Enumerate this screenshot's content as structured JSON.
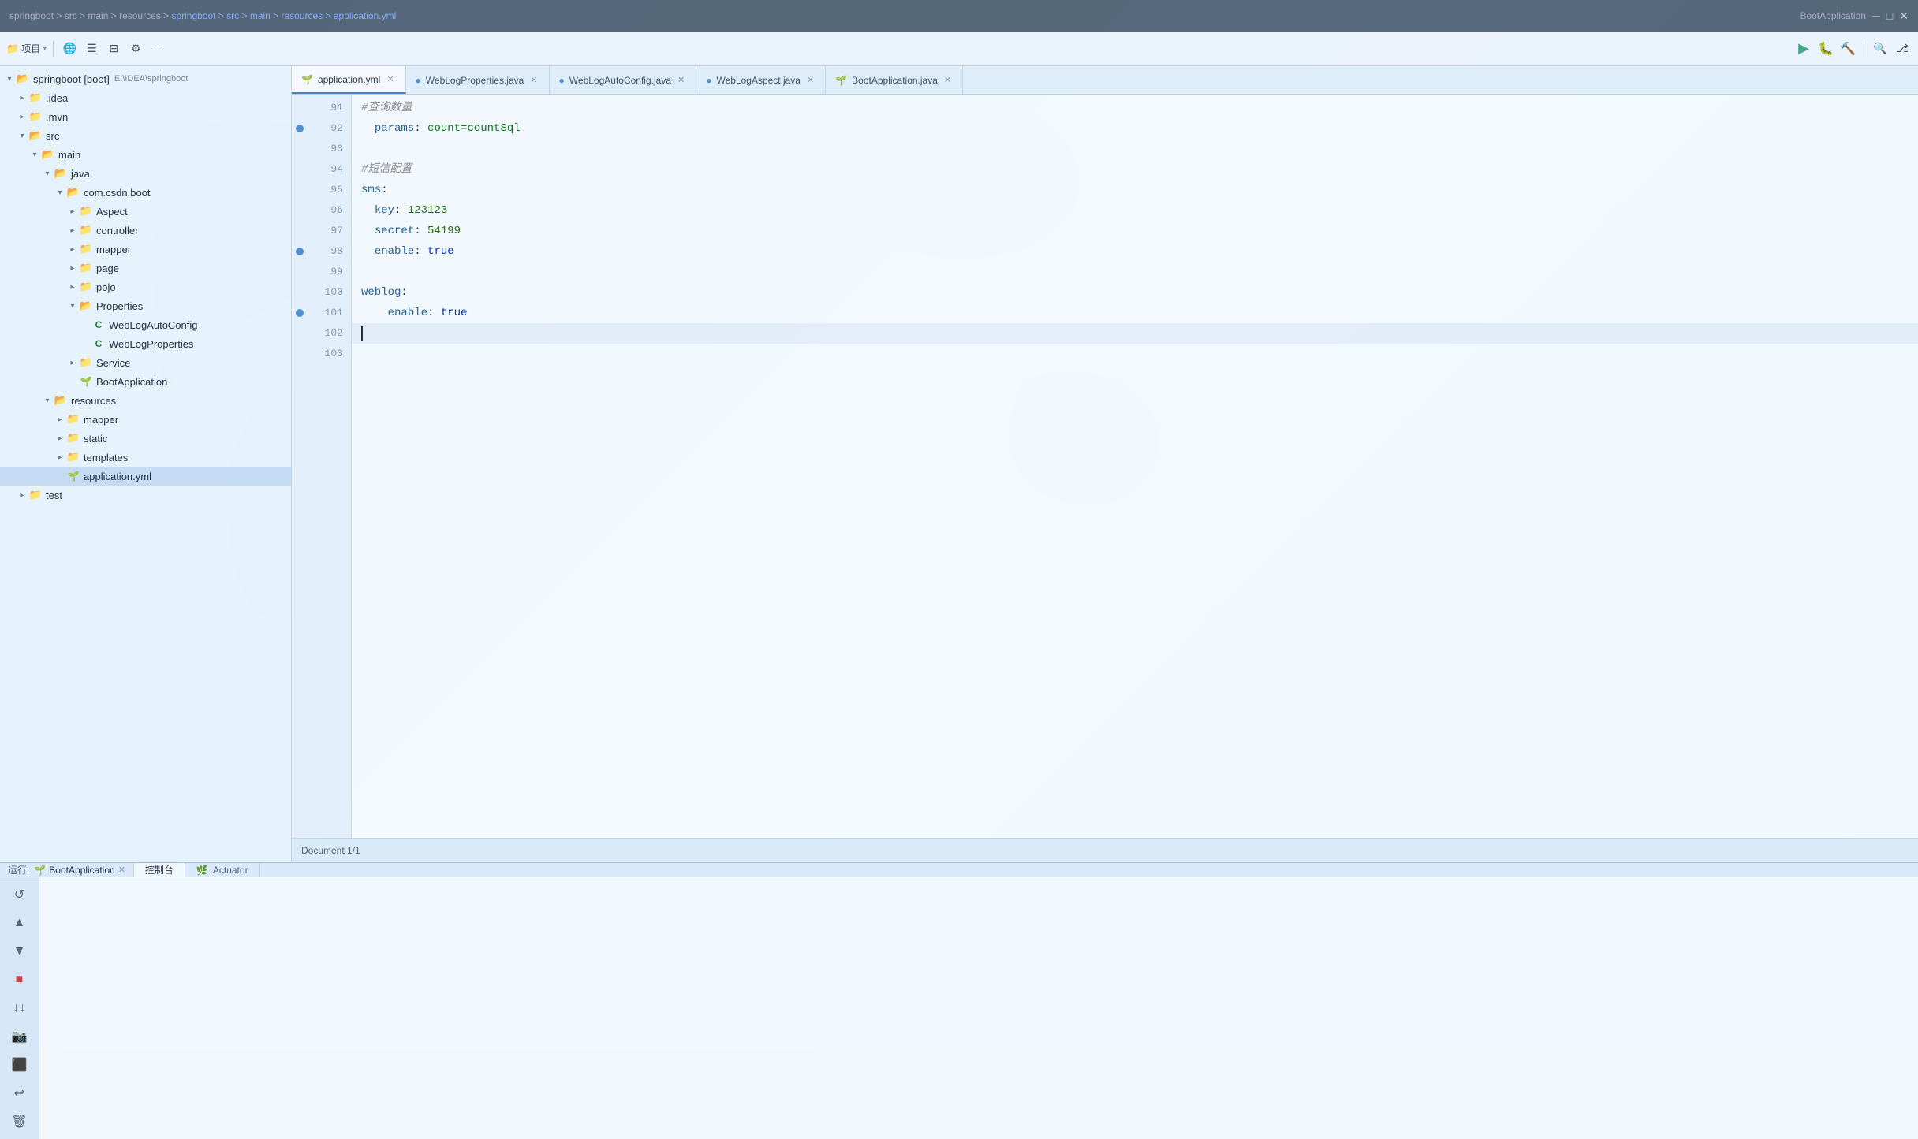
{
  "titleBar": {
    "path": "springboot > src > main > resources > application.yml",
    "appName": "BootApplication"
  },
  "toolbar": {
    "projectLabel": "项目",
    "icons": [
      "globe",
      "align-center",
      "settings",
      "minimize"
    ]
  },
  "tabs": [
    {
      "id": "application-yml",
      "label": "application.yml",
      "type": "yaml",
      "active": true
    },
    {
      "id": "weblog-properties",
      "label": "WebLogProperties.java",
      "type": "java",
      "active": false
    },
    {
      "id": "weblog-autoconfig",
      "label": "WebLogAutoConfig.java",
      "type": "java",
      "active": false
    },
    {
      "id": "weblog-aspect",
      "label": "WebLogAspect.java",
      "type": "java",
      "active": false
    },
    {
      "id": "boot-application",
      "label": "BootApplication.java",
      "type": "java",
      "active": false
    }
  ],
  "sidebar": {
    "rootLabel": "springboot [boot]",
    "rootPath": "E:\\IDEA\\springboot",
    "tree": [
      {
        "id": "idea",
        "label": ".idea",
        "type": "folder",
        "level": 1,
        "expanded": false
      },
      {
        "id": "mvn",
        "label": ".mvn",
        "type": "folder",
        "level": 1,
        "expanded": false
      },
      {
        "id": "src",
        "label": "src",
        "type": "folder",
        "level": 1,
        "expanded": true
      },
      {
        "id": "main",
        "label": "main",
        "type": "folder",
        "level": 2,
        "expanded": true
      },
      {
        "id": "java",
        "label": "java",
        "type": "folder",
        "level": 3,
        "expanded": true
      },
      {
        "id": "com-csdn-boot",
        "label": "com.csdn.boot",
        "type": "folder",
        "level": 4,
        "expanded": true
      },
      {
        "id": "aspect",
        "label": "Aspect",
        "type": "folder",
        "level": 5,
        "expanded": false
      },
      {
        "id": "controller",
        "label": "controller",
        "type": "folder",
        "level": 5,
        "expanded": false
      },
      {
        "id": "mapper",
        "label": "mapper",
        "type": "folder",
        "level": 5,
        "expanded": false
      },
      {
        "id": "page",
        "label": "page",
        "type": "folder",
        "level": 5,
        "expanded": false
      },
      {
        "id": "pojo",
        "label": "pojo",
        "type": "folder",
        "level": 5,
        "expanded": false
      },
      {
        "id": "properties",
        "label": "Properties",
        "type": "folder",
        "level": 5,
        "expanded": true
      },
      {
        "id": "weblogautoconfig",
        "label": "WebLogAutoConfig",
        "type": "java-spring",
        "level": 6
      },
      {
        "id": "weblogproperties",
        "label": "WebLogProperties",
        "type": "java-spring",
        "level": 6
      },
      {
        "id": "service",
        "label": "Service",
        "type": "folder",
        "level": 5,
        "expanded": false
      },
      {
        "id": "bootapplication",
        "label": "BootApplication",
        "type": "java-spring",
        "level": 5
      },
      {
        "id": "resources",
        "label": "resources",
        "type": "folder",
        "level": 3,
        "expanded": true
      },
      {
        "id": "mapper-res",
        "label": "mapper",
        "type": "folder",
        "level": 4,
        "expanded": false
      },
      {
        "id": "static",
        "label": "static",
        "type": "folder",
        "level": 4,
        "expanded": false
      },
      {
        "id": "templates",
        "label": "templates",
        "type": "folder",
        "level": 4,
        "expanded": false
      },
      {
        "id": "appyml",
        "label": "application.yml",
        "type": "yaml",
        "level": 4,
        "selected": true
      },
      {
        "id": "test",
        "label": "test",
        "type": "folder",
        "level": 1,
        "expanded": false
      }
    ]
  },
  "codeLines": [
    {
      "num": 91,
      "content": "#查询数量",
      "type": "comment"
    },
    {
      "num": 92,
      "content": "  params: count=countSql",
      "bookmark": true
    },
    {
      "num": 93,
      "content": ""
    },
    {
      "num": 94,
      "content": "#短信配置",
      "type": "comment"
    },
    {
      "num": 95,
      "content": "sms:",
      "key": "sms"
    },
    {
      "num": 96,
      "content": "  key: 123123"
    },
    {
      "num": 97,
      "content": "  secret: 54199"
    },
    {
      "num": 98,
      "content": "  enable: true",
      "bookmark": true
    },
    {
      "num": 99,
      "content": ""
    },
    {
      "num": 100,
      "content": "weblog:"
    },
    {
      "num": 101,
      "content": "    enable: true",
      "bookmark": true
    },
    {
      "num": 102,
      "content": ""
    },
    {
      "num": 103,
      "content": ""
    }
  ],
  "statusBar": {
    "text": "Document 1/1"
  },
  "bottomPanel": {
    "runLabel": "运行:",
    "appLabel": "BootApplication",
    "tabs": [
      {
        "id": "console",
        "label": "控制台",
        "active": true
      },
      {
        "id": "actuator",
        "label": "Actuator",
        "active": false
      }
    ]
  }
}
